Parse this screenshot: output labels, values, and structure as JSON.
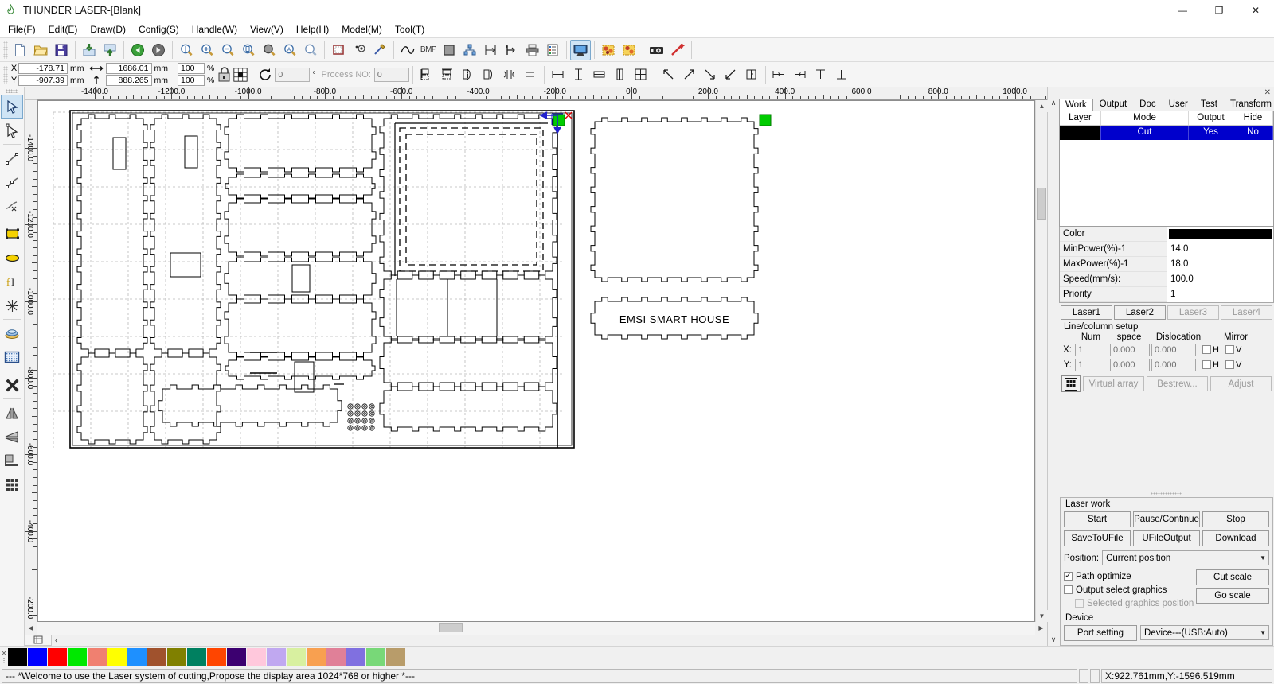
{
  "window": {
    "title": "THUNDER LASER-[Blank]",
    "app_icon": "flame-icon",
    "minimize": "—",
    "maximize": "❐",
    "close": "✕"
  },
  "menu": {
    "items": [
      {
        "label": "File(F)",
        "name": "menu-file"
      },
      {
        "label": "Edit(E)",
        "name": "menu-edit"
      },
      {
        "label": "Draw(D)",
        "name": "menu-draw"
      },
      {
        "label": "Config(S)",
        "name": "menu-config"
      },
      {
        "label": "Handle(W)",
        "name": "menu-handle"
      },
      {
        "label": "View(V)",
        "name": "menu-view"
      },
      {
        "label": "Help(H)",
        "name": "menu-help"
      },
      {
        "label": "Model(M)",
        "name": "menu-model"
      },
      {
        "label": "Tool(T)",
        "name": "menu-tool"
      }
    ]
  },
  "toolbar_main": {
    "groups": [
      [
        "new-file-icon",
        "open-folder-icon",
        "save-icon"
      ],
      [
        "import-icon",
        "export-icon"
      ],
      [
        "undo-icon",
        "redo-icon"
      ],
      [
        "zoom-pan-icon",
        "zoom-in-icon",
        "zoom-out-icon",
        "zoom-page-icon",
        "zoom-selection-icon",
        "zoom-all-icon",
        "zoom-window-icon"
      ],
      [
        "frame-icon",
        "node-edit-icon",
        "path-edit-icon"
      ],
      [
        "curve-icon",
        "bmp-icon",
        "fill-icon",
        "group-node-icon",
        "offset-icon",
        "arrow-seq-icon",
        "print-icon",
        "list-icon"
      ],
      [
        "preview-icon"
      ],
      [
        "bitmap-trace-icon",
        "bitmap-process-icon"
      ],
      [
        "camera-icon",
        "wizard-icon"
      ]
    ],
    "bmp_label": "BMP"
  },
  "prop_toolbar": {
    "x_label": "X",
    "y_label": "Y",
    "x_value": "-178.71",
    "y_value": "-907.39",
    "unit": "mm",
    "width_value": "1686.01",
    "height_value": "888.265",
    "width_unit": "mm",
    "height_unit": "mm",
    "scale_x": "100",
    "scale_y": "100",
    "percent": "%",
    "lock_icon": "lock-aspect-icon",
    "anchor_icon": "anchor-grid-icon",
    "rotate_icon": "rotate-icon",
    "angle_value": "0",
    "degree": "°",
    "process_label": "Process NO:",
    "process_value": "0",
    "align_groups": [
      [
        "align-left-flip-icon",
        "align-top-flip-icon",
        "mirror-h-icon",
        "mirror-v-icon",
        "flip-h-icon",
        "flip-v-icon"
      ],
      [
        "dist-h-icon",
        "dist-v-icon",
        "same-width-icon",
        "same-height-icon",
        "same-size-icon"
      ],
      [
        "align-topleft-icon",
        "align-topright-icon",
        "align-bottomright-icon",
        "align-bottomleft-icon",
        "align-center-icon"
      ],
      [
        "measure-left-icon",
        "measure-right-icon",
        "measure-top-icon",
        "measure-bottom-icon"
      ]
    ]
  },
  "left_palette": {
    "items": [
      {
        "name": "select-tool",
        "icon": "arrow-select-icon",
        "active": true
      },
      {
        "name": "node-tool",
        "icon": "node-select-icon",
        "active": false
      },
      {
        "name": "line-tool",
        "icon": "line-icon",
        "active": false
      },
      {
        "name": "polyline-tool",
        "icon": "polyline-icon",
        "active": false
      },
      {
        "name": "bezier-tool",
        "icon": "bezier-icon",
        "active": false
      },
      {
        "name": "rectangle-tool",
        "icon": "rectangle-icon",
        "active": false
      },
      {
        "name": "ellipse-tool",
        "icon": "ellipse-icon",
        "active": false
      },
      {
        "name": "text-tool",
        "icon": "text-icon",
        "active": false
      },
      {
        "name": "explode-tool",
        "icon": "star-burst-icon",
        "active": false
      },
      {
        "name": "capture-tool",
        "icon": "capture-icon",
        "active": false
      },
      {
        "name": "bitmap-tool",
        "icon": "bitmap-grid-icon",
        "active": false
      },
      {
        "name": "delete-tool",
        "icon": "delete-x-icon",
        "active": false
      },
      {
        "name": "mirror-horizontal-tool",
        "icon": "mirror-horizontal-icon",
        "active": false
      },
      {
        "name": "mirror-vertical-tool",
        "icon": "mirror-vertical-icon",
        "active": false
      },
      {
        "name": "align-tool",
        "icon": "align-corner-icon",
        "active": false
      },
      {
        "name": "array-tool",
        "icon": "array-grid-icon",
        "active": false
      }
    ]
  },
  "ruler": {
    "h_labels": [
      "-1400.0",
      "-1200.0",
      "-1000.0",
      "-800.0",
      "-600.0",
      "-400.0",
      "-200.0",
      "0.0",
      "200.0",
      "400.0",
      "600.0",
      "800.0",
      "1000.0"
    ],
    "v_labels": [
      "-1400.0",
      "-1200.0",
      "-1000.0",
      "-800.0",
      "-600.0",
      "-400.0",
      "-200.0"
    ]
  },
  "right_panel": {
    "close_glyph": "✕",
    "collapse_up": "∧",
    "collapse_down": "∨",
    "tabs": [
      {
        "label": "Work",
        "name": "tab-work",
        "selected": true
      },
      {
        "label": "Output",
        "name": "tab-output",
        "selected": false
      },
      {
        "label": "Doc",
        "name": "tab-doc",
        "selected": false
      },
      {
        "label": "User",
        "name": "tab-user",
        "selected": false
      },
      {
        "label": "Test",
        "name": "tab-test",
        "selected": false
      },
      {
        "label": "Transform",
        "name": "tab-transform",
        "selected": false
      }
    ],
    "layer_table": {
      "headers": [
        "Layer",
        "Mode",
        "Output",
        "Hide"
      ],
      "rows": [
        {
          "layer_color": "#000000",
          "mode": "Cut",
          "output": "Yes",
          "hide": "No"
        }
      ]
    },
    "properties": [
      {
        "key": "Color",
        "value": "",
        "swatch": "#000000"
      },
      {
        "key": "MinPower(%)-1",
        "value": "14.0"
      },
      {
        "key": "MaxPower(%)-1",
        "value": "18.0"
      },
      {
        "key": "Speed(mm/s):",
        "value": "100.0"
      },
      {
        "key": "Priority",
        "value": "1"
      }
    ],
    "laser_tabs": [
      {
        "label": "Laser1",
        "name": "laser1-button",
        "disabled": false
      },
      {
        "label": "Laser2",
        "name": "laser2-button",
        "disabled": false
      },
      {
        "label": "Laser3",
        "name": "laser3-button",
        "disabled": true
      },
      {
        "label": "Laser4",
        "name": "laser4-button",
        "disabled": true
      }
    ],
    "line_column": {
      "title": "Line/column setup",
      "headers": [
        "Num",
        "space",
        "Dislocation",
        "Mirror"
      ],
      "rows": [
        {
          "axis": "X:",
          "num": "1",
          "space": "0.000",
          "dislocation": "0.000",
          "mirror_label": "H",
          "mirror_label2": "V"
        },
        {
          "axis": "Y:",
          "num": "1",
          "space": "0.000",
          "dislocation": "0.000",
          "mirror_label": "H",
          "mirror_label2": "V"
        }
      ]
    },
    "array_bar": {
      "grid_icon": "array-grid-icon",
      "buttons": [
        {
          "label": "Virtual array",
          "name": "virtual-array-button"
        },
        {
          "label": "Bestrew...",
          "name": "bestrew-button"
        },
        {
          "label": "Adjust",
          "name": "adjust-button"
        }
      ]
    },
    "laser_work": {
      "title": "Laser work",
      "row1": [
        {
          "label": "Start",
          "name": "start-button"
        },
        {
          "label": "Pause/Continue",
          "name": "pause-continue-button"
        },
        {
          "label": "Stop",
          "name": "stop-button"
        }
      ],
      "row2": [
        {
          "label": "SaveToUFile",
          "name": "save-to-ufile-button"
        },
        {
          "label": "UFileOutput",
          "name": "ufile-output-button"
        },
        {
          "label": "Download",
          "name": "download-button"
        }
      ],
      "position_label": "Position:",
      "position_value": "Current position",
      "checkboxes": [
        {
          "label": "Path optimize",
          "checked": true,
          "disabled": false,
          "name": "path-optimize-checkbox"
        },
        {
          "label": "Output select graphics",
          "checked": false,
          "disabled": false,
          "name": "output-select-graphics-checkbox"
        },
        {
          "label": "Selected graphics position",
          "checked": false,
          "disabled": true,
          "name": "selected-graphics-position-checkbox"
        }
      ],
      "scale_buttons": [
        {
          "label": "Cut scale",
          "name": "cut-scale-button"
        },
        {
          "label": "Go scale",
          "name": "go-scale-button"
        }
      ]
    },
    "device": {
      "title": "Device",
      "port_setting_label": "Port setting",
      "device_value": "Device---(USB:Auto)"
    }
  },
  "palette": {
    "colors": [
      "#000000",
      "#0000ff",
      "#ff0000",
      "#00e800",
      "#f08070",
      "#ffff00",
      "#1e90ff",
      "#a0522d",
      "#808000",
      "#008060",
      "#ff4500",
      "#3c0070",
      "#ffc8dc",
      "#c0a8f0",
      "#d8f0a0",
      "#f8a050",
      "#e08098",
      "#8070e0",
      "#78d878",
      "#b89c6a"
    ]
  },
  "statusbar": {
    "message": "--- *Welcome to use the Laser system of cutting,Propose the display area 1024*768 or higher *---",
    "coordinates": "X:922.761mm,Y:-1596.519mm"
  },
  "canvas": {
    "label_text": "EMSI SMART HOUSE",
    "selection_handle_color": "#00cc00",
    "origin_marker_color": "#0000cc"
  }
}
